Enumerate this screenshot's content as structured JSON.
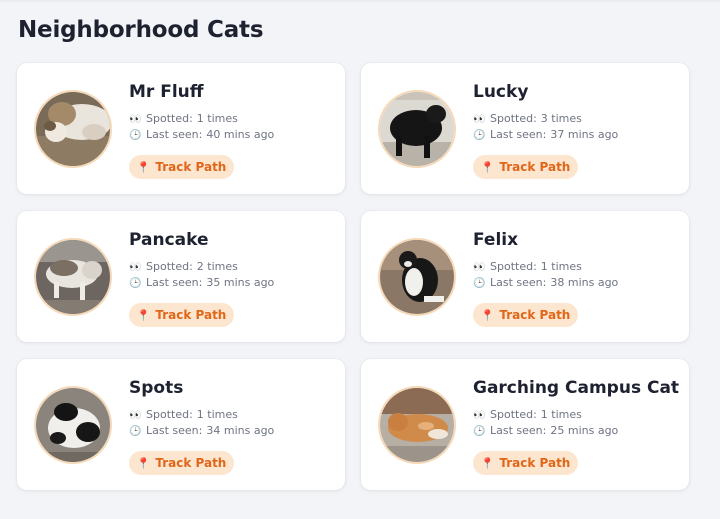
{
  "page": {
    "title": "Neighborhood Cats"
  },
  "labels": {
    "spotted": "Spotted:",
    "last_seen": "Last seen:",
    "track": "Track Path",
    "eyes_icon": "👀",
    "clock_icon": "🕒",
    "pin_icon": "📍"
  },
  "cats": [
    {
      "name": "Mr Fluff",
      "spotted": "1 times",
      "last_seen": "40 mins ago"
    },
    {
      "name": "Lucky",
      "spotted": "3 times",
      "last_seen": "37 mins ago"
    },
    {
      "name": "Pancake",
      "spotted": "2 times",
      "last_seen": "35 mins ago"
    },
    {
      "name": "Felix",
      "spotted": "1 times",
      "last_seen": "38 mins ago"
    },
    {
      "name": "Spots",
      "spotted": "1 times",
      "last_seen": "34 mins ago"
    },
    {
      "name": "Garching Campus Cat",
      "spotted": "1 times",
      "last_seen": "25 mins ago"
    }
  ],
  "colors": {
    "accent": "#e0661a",
    "button_bg": "#fde6cf",
    "avatar_ring": "#f5d9b8",
    "background": "#f3f4f7"
  }
}
